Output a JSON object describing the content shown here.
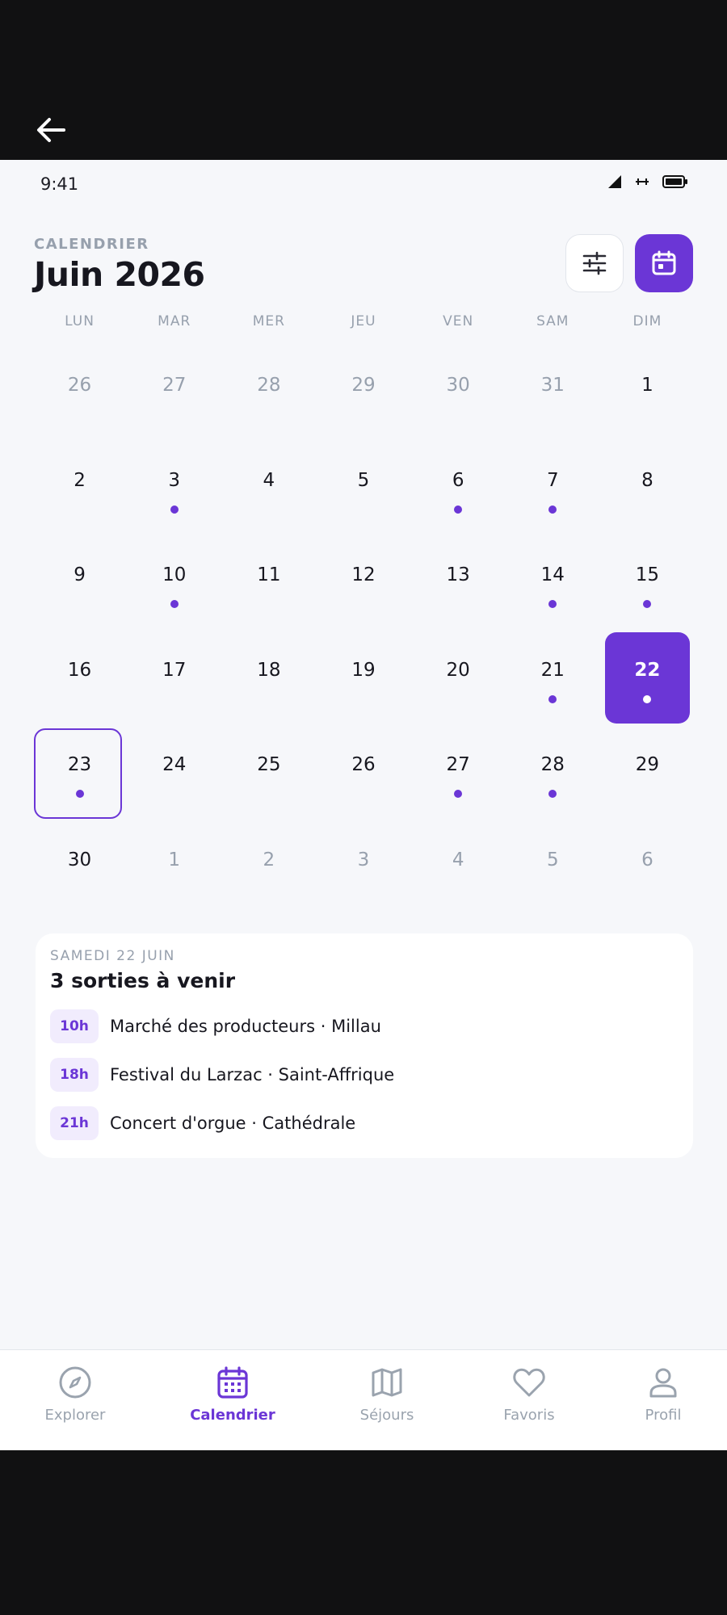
{
  "status_bar": {
    "time": "9:41"
  },
  "header": {
    "section_label": "CALENDRIER",
    "month_title": "Juin 2026"
  },
  "weekdays": [
    "LUN",
    "MAR",
    "MER",
    "JEU",
    "VEN",
    "SAM",
    "DIM"
  ],
  "weeks": [
    [
      {
        "d": "26",
        "other": true
      },
      {
        "d": "27",
        "other": true
      },
      {
        "d": "28",
        "other": true
      },
      {
        "d": "29",
        "other": true
      },
      {
        "d": "30",
        "other": true
      },
      {
        "d": "31",
        "other": true
      },
      {
        "d": "1"
      }
    ],
    [
      {
        "d": "2"
      },
      {
        "d": "3",
        "dot": true
      },
      {
        "d": "4"
      },
      {
        "d": "5"
      },
      {
        "d": "6",
        "dot": true
      },
      {
        "d": "7",
        "dot": true
      },
      {
        "d": "8"
      }
    ],
    [
      {
        "d": "9"
      },
      {
        "d": "10",
        "dot": true
      },
      {
        "d": "11"
      },
      {
        "d": "12"
      },
      {
        "d": "13"
      },
      {
        "d": "14",
        "dot": true
      },
      {
        "d": "15",
        "dot": true
      }
    ],
    [
      {
        "d": "16"
      },
      {
        "d": "17"
      },
      {
        "d": "18"
      },
      {
        "d": "19"
      },
      {
        "d": "20"
      },
      {
        "d": "21",
        "dot": true
      },
      {
        "d": "22",
        "dot": true,
        "selected": true
      }
    ],
    [
      {
        "d": "23",
        "dot": true,
        "today": true
      },
      {
        "d": "24"
      },
      {
        "d": "25"
      },
      {
        "d": "26"
      },
      {
        "d": "27",
        "dot": true
      },
      {
        "d": "28",
        "dot": true
      },
      {
        "d": "29"
      }
    ],
    [
      {
        "d": "30"
      },
      {
        "d": "1",
        "other": true
      },
      {
        "d": "2",
        "other": true
      },
      {
        "d": "3",
        "other": true
      },
      {
        "d": "4",
        "other": true
      },
      {
        "d": "5",
        "other": true
      },
      {
        "d": "6",
        "other": true
      }
    ]
  ],
  "events": {
    "date_label": "SAMEDI 22 JUIN",
    "title": "3 sorties à venir",
    "items": [
      {
        "time": "10h",
        "title": "Marché des producteurs · Millau"
      },
      {
        "time": "18h",
        "title": "Festival du Larzac · Saint-Affrique"
      },
      {
        "time": "21h",
        "title": "Concert d'orgue · Cathédrale"
      }
    ]
  },
  "nav": [
    {
      "label": "Explorer",
      "icon": "compass-icon"
    },
    {
      "label": "Calendrier",
      "icon": "calendar-icon",
      "active": true
    },
    {
      "label": "Séjours",
      "icon": "map-icon"
    },
    {
      "label": "Favoris",
      "icon": "heart-icon"
    },
    {
      "label": "Profil",
      "icon": "user-icon"
    }
  ],
  "colors": {
    "accent": "#6b36d6",
    "muted": "#97a0ad",
    "text": "#17171f",
    "background": "#f6f7fa"
  }
}
